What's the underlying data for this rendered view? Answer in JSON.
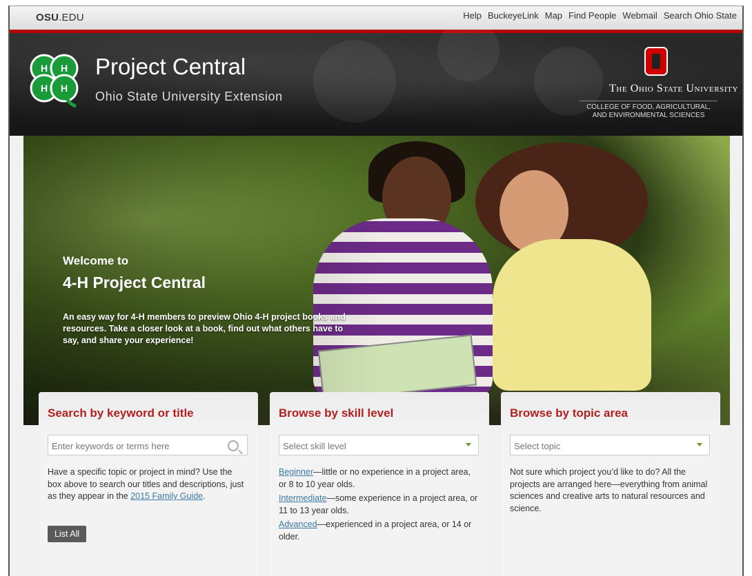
{
  "osu_bar": {
    "logo_bold": "OSU",
    "logo_rest": ".EDU",
    "links": [
      "Help",
      "BuckeyeLink",
      "Map",
      "Find People",
      "Webmail",
      "Search Ohio State"
    ]
  },
  "header": {
    "title": "Project Central",
    "subtitle": "Ohio State University Extension",
    "university": "The Ohio State University",
    "college_line1": "COLLEGE OF FOOD, AGRICULTURAL,",
    "college_line2": "AND ENVIRONMENTAL SCIENCES",
    "clover_letter": "H"
  },
  "hero": {
    "welcome": "Welcome to",
    "title": "4-H Project Central",
    "description": "An easy way for 4-H members to preview Ohio 4-H project books and resources. Take a closer look at a book, find out what others have to say, and share your experience!"
  },
  "cards": {
    "search": {
      "heading": "Search by keyword or title",
      "placeholder": "Enter keywords or terms here",
      "text_before_link": "Have a specific topic or project in mind? Use the box above to search our titles and descriptions, just as they appear in the ",
      "link_text": "2015 Family Guide",
      "text_after_link": ".",
      "button": "List All"
    },
    "skill": {
      "heading": "Browse by skill level",
      "select_value": "Select skill level",
      "levels": [
        {
          "name": "Beginner",
          "text": "—little or no experience in a project area, or 8 to 10 year olds."
        },
        {
          "name": "Intermediate",
          "text": "—some experience in a project area, or 11 to 13 year olds."
        },
        {
          "name": "Advanced",
          "text": "—experienced in a project area, or 14 or older."
        }
      ]
    },
    "topic": {
      "heading": "Browse by topic area",
      "select_value": "Select topic",
      "description": "Not sure which project you’d like to do? All the projects are arranged here—everything from animal sciences and creative arts to natural resources and science."
    }
  },
  "colors": {
    "osu_red": "#b00000",
    "heading_red": "#b21f1f",
    "link_blue": "#3d7aa6",
    "clover_green": "#1a9b3a"
  }
}
